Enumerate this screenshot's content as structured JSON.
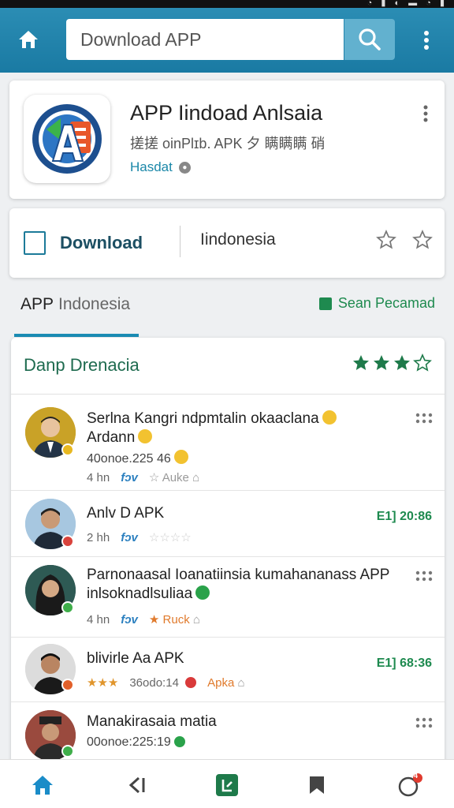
{
  "search": {
    "value": "Download APP"
  },
  "app": {
    "title": "APP Iindoad Anlsaia",
    "subtitle": "搓搓 oinPlɪb. APK 夕 瞒瞒瞒 硝",
    "developer": "Hasdat"
  },
  "actions": {
    "download_label": "Download",
    "region_label": "Iindonesia"
  },
  "tabs": {
    "active_label_1": "APP",
    "active_label_2": "Indonesia",
    "right_label": "Sean Pecamad"
  },
  "list": {
    "title": "Danp Drenacia",
    "rating_stars": 3,
    "rows": [
      {
        "line1": "Serlna Kangri ndpmtalin okaaclana",
        "line2": "Ardann",
        "line3": "40onoe.225 46",
        "meta_time": "4 hn",
        "meta_tag": "fɔv",
        "meta_action": "Auke"
      },
      {
        "line1": "Anlv D APK",
        "time": "E1] 20:86",
        "meta_time": "2 hh",
        "meta_tag": "fɔv"
      },
      {
        "line1": "Parnonaasal Ioanatiinsia kumahananass APP",
        "line2": "inlsoknadlsuliaa",
        "meta_time": "4 hn",
        "meta_tag": "fɔv",
        "meta_action": "Ruck"
      },
      {
        "line1": "blivirle Aa APK",
        "time": "E1] 68:36",
        "line3": "36odo:14",
        "meta_action": "Apka"
      },
      {
        "line1": "Manakirasaia matia",
        "line3": "00onoe:225:19"
      }
    ]
  },
  "colors": {
    "topbar": "#1a7aa3",
    "accent_green": "#1e8a4f",
    "accent_blue": "#1a8cb3"
  },
  "bottom_nav": {
    "badge": "4",
    "icons": [
      "home-icon",
      "back-icon",
      "store-icon",
      "bookmark-icon",
      "profile-icon"
    ]
  }
}
